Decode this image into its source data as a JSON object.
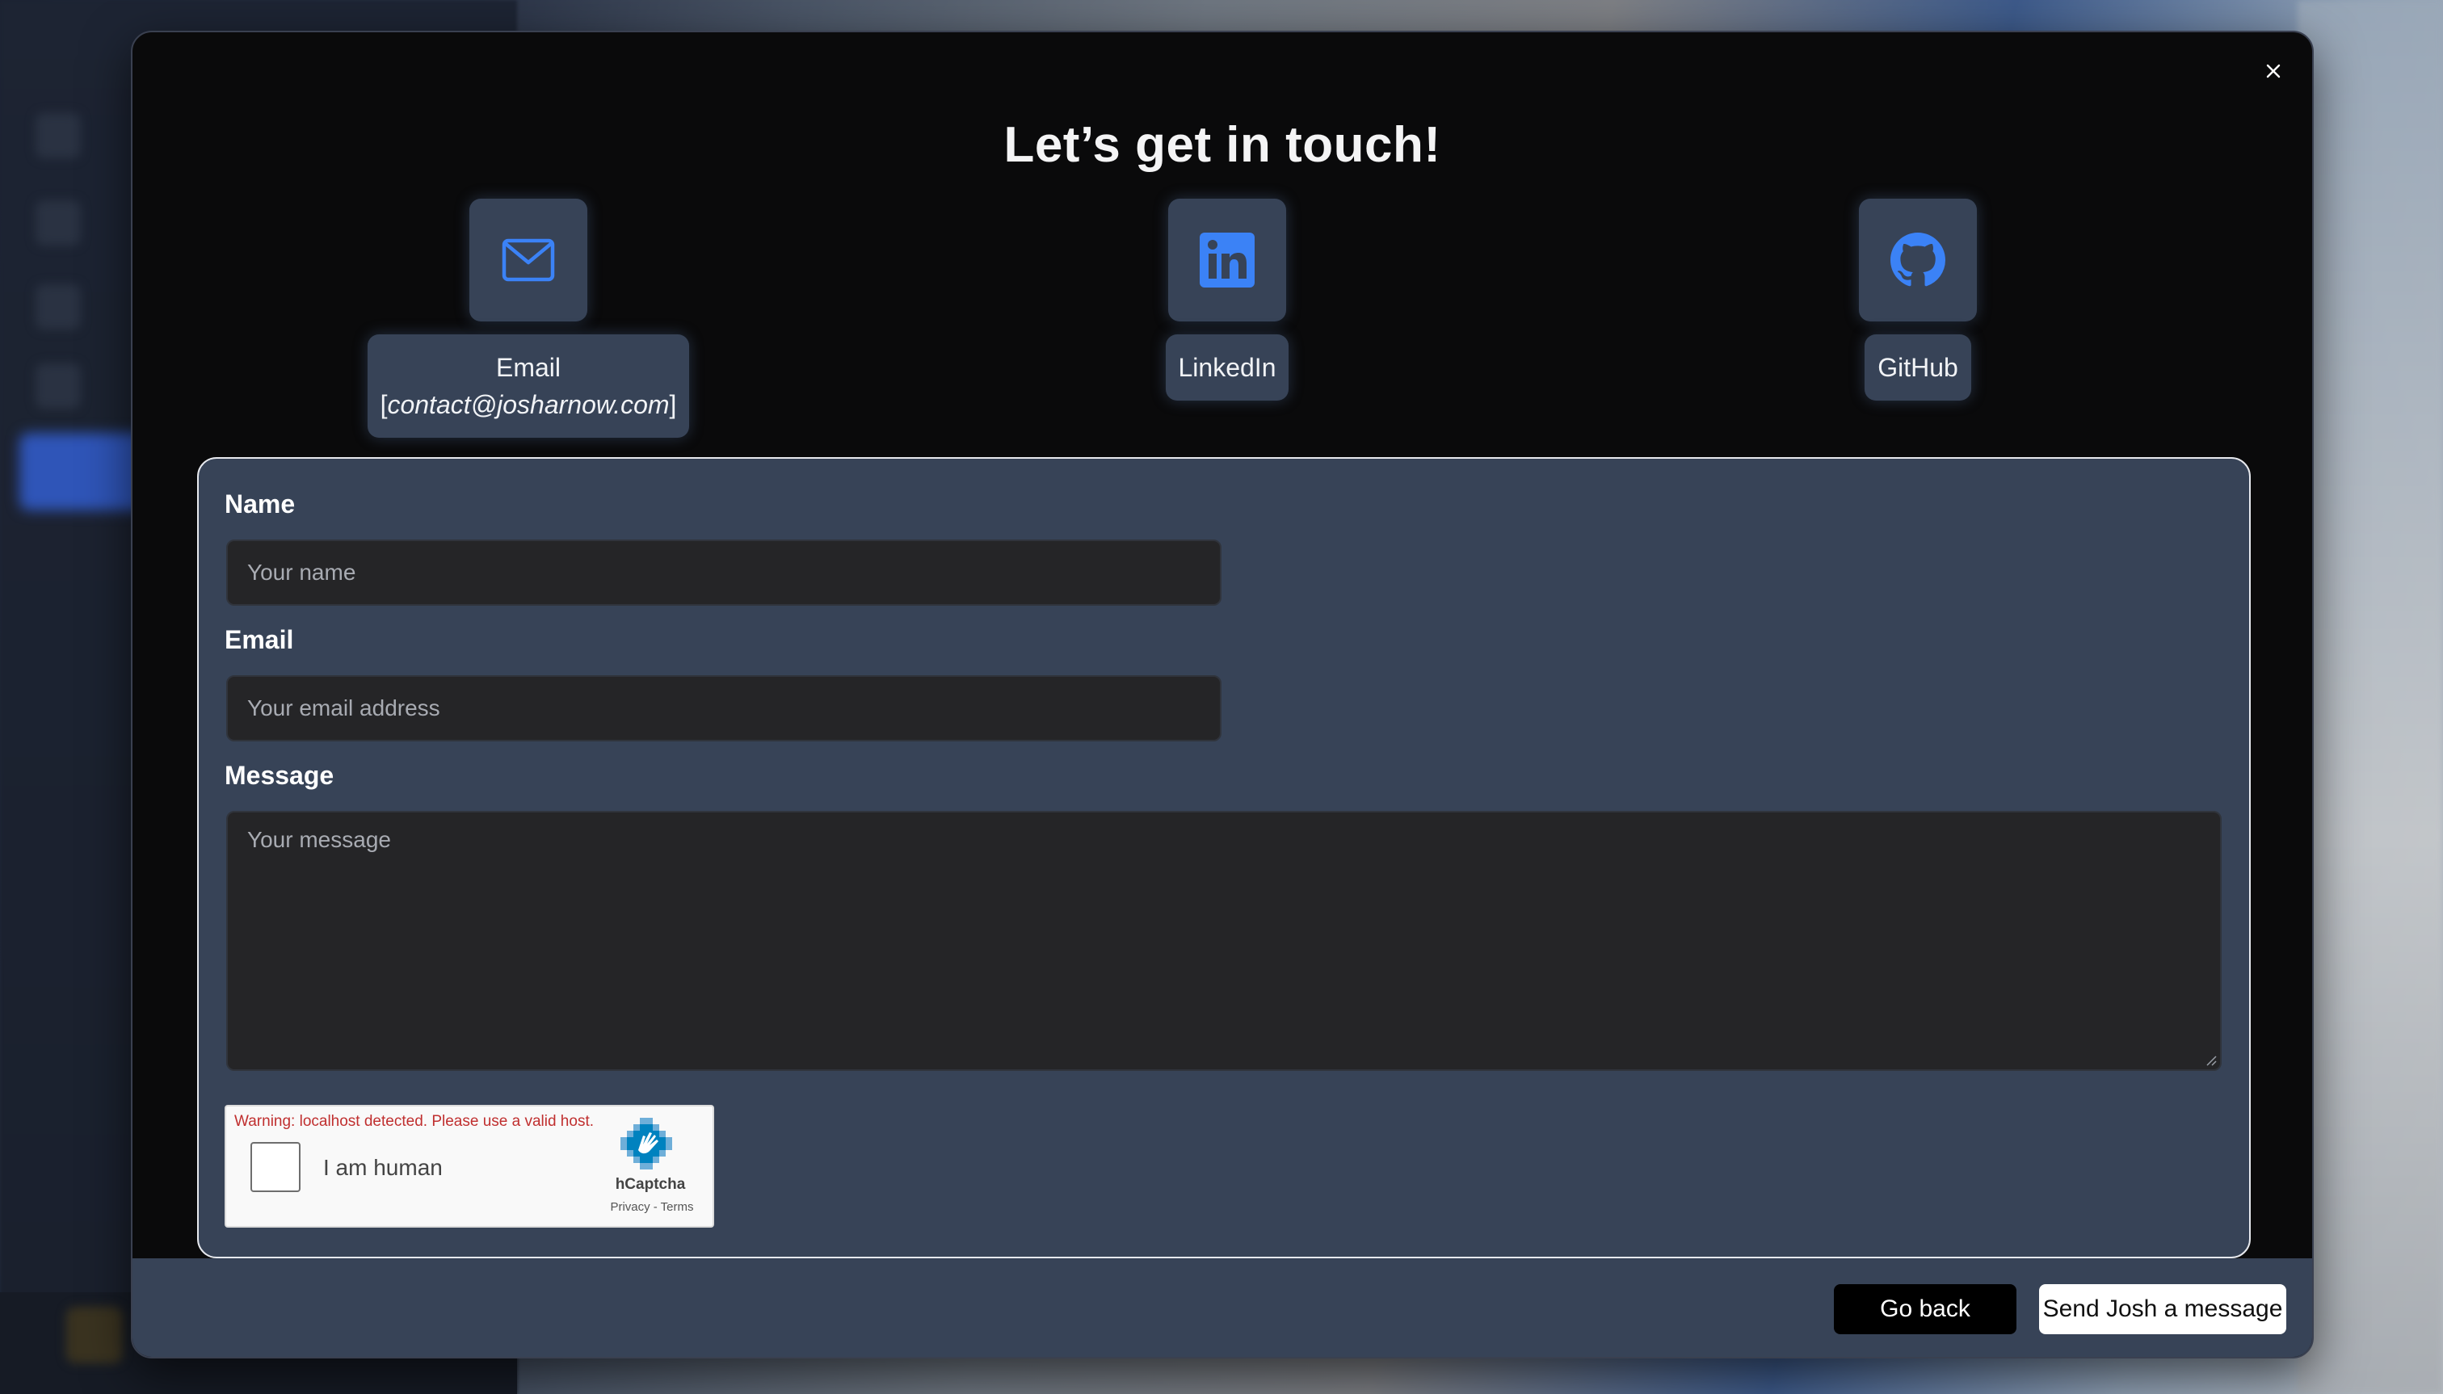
{
  "modal": {
    "title": "Let’s get in touch!",
    "close_icon": "close-icon"
  },
  "contacts": [
    {
      "icon": "mail-icon",
      "label": "Email",
      "detail": "contact@josharnow.com",
      "bracket_open": "[",
      "bracket_close": "]"
    },
    {
      "icon": "linkedin-icon",
      "label": "LinkedIn"
    },
    {
      "icon": "github-icon",
      "label": "GitHub"
    }
  ],
  "colors": {
    "accent_icon": "#3b82f6",
    "panel": "#374357",
    "input_bg": "#252527"
  },
  "form": {
    "name_label": "Name",
    "name_placeholder": "Your name",
    "email_label": "Email",
    "email_placeholder": "Your email address",
    "message_label": "Message",
    "message_placeholder": "Your message"
  },
  "captcha": {
    "warning": "Warning: localhost detected. Please use a valid host.",
    "checkbox_label": "I am human",
    "brand": "hCaptcha",
    "links": "Privacy - Terms"
  },
  "footer": {
    "back_label": "Go back",
    "send_label": "Send Josh a message"
  }
}
